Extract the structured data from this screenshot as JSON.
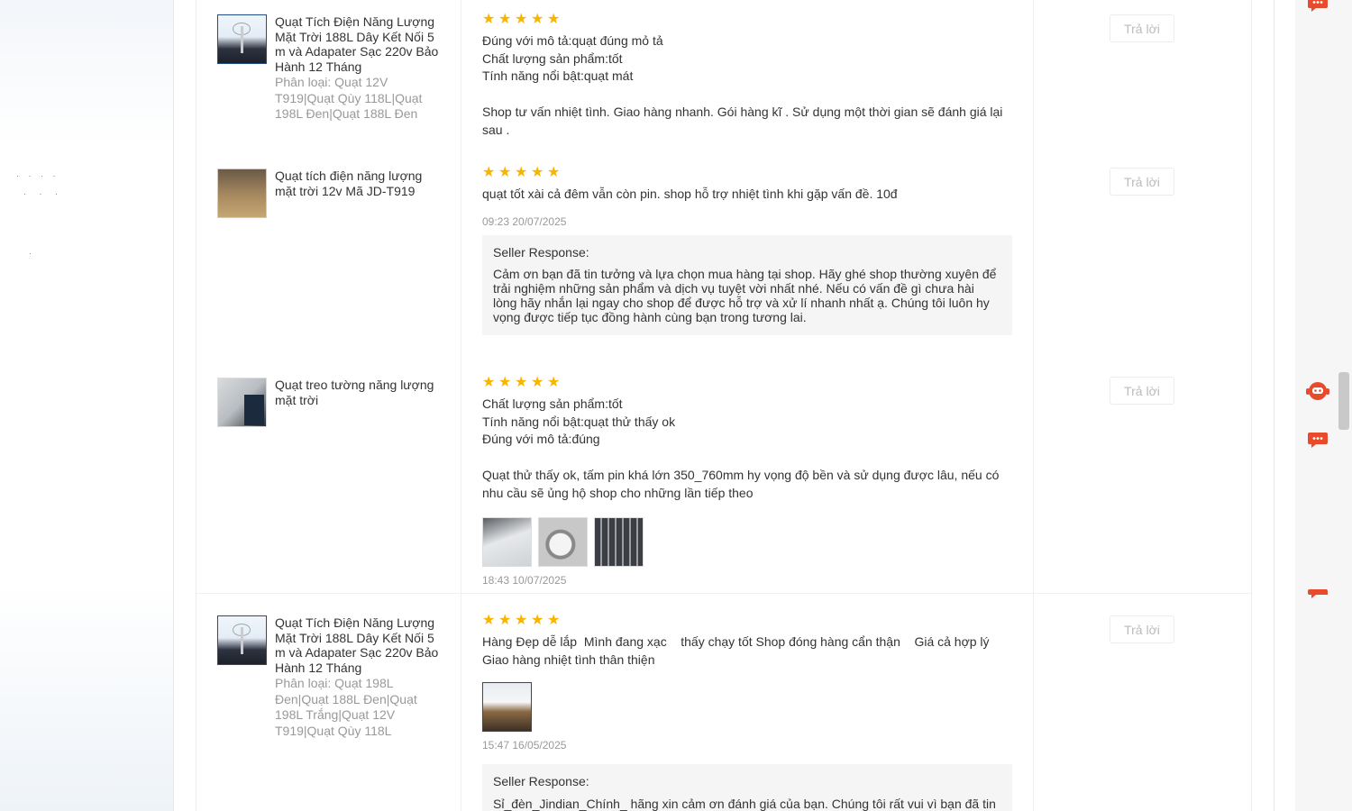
{
  "reviews": [
    {
      "product_name": "Quạt Tích Điện Năng Lượng Mặt Trời 188L Dây Kết Nối 5 m và Adapater Sạc 220v Bảo Hành 12 Tháng",
      "variant": "Phân loại: Quạt 12V T919|Quạt Qùy 118L|Quạt 198L Đen|Quạt 188L Đen",
      "rating": 5,
      "lines": [
        "Đúng với mô tả:quạt đúng mỏ tả",
        "Chất lượng sản phẩm:tốt",
        "Tính năng nổi bật:quạt mát"
      ],
      "comment": "Shop tư vấn nhiệt tình. Giao hàng nhanh. Gói hàng kĩ . Sử dụng một thời gian sẽ đánh giá lại sau .",
      "reply_label": "Trả lời"
    },
    {
      "product_name": "Quạt tích điện năng lượng mặt trời 12v Mã JD-T919",
      "rating": 5,
      "comment": "quạt tốt xài cả đêm vẫn còn pin. shop hỗ trợ nhiệt tình khi gặp vấn đề. 10đ",
      "time": "09:23 20/07/2025",
      "seller_title": "Seller Response:",
      "seller_text": "Cảm ơn bạn đã tin tưởng và lựa chọn mua hàng tại shop. Hãy ghé shop thường xuyên để trải nghiệm những sản phẩm và dịch vụ tuyệt vời nhất nhé. Nếu có vấn đề gì chưa hài lòng hãy nhắn lại ngay cho shop để được hỗ trợ và xử lí nhanh nhất ạ. Chúng tôi luôn hy vọng được tiếp tục đồng hành cùng bạn trong tương lai.",
      "reply_label": "Trả lời"
    },
    {
      "product_name": "Quạt treo tường năng lượng mặt trời",
      "rating": 5,
      "lines": [
        "Chất lượng sản phẩm:tốt",
        "Tính năng nổi bật:quạt thử thấy ok",
        "Đúng với mô tả:đúng"
      ],
      "comment": "Quạt thử thấy ok, tấm pin khá lớn 350_760mm hy vọng độ bền và sử dụng được lâu, nếu có nhu cầu sẽ ủng hộ shop cho những lần tiếp theo",
      "time": "18:43 10/07/2025",
      "reply_label": "Trả lời"
    },
    {
      "product_name": "Quạt Tích Điện Năng Lượng Mặt Trời 188L Dây Kết Nối 5 m và Adapater Sạc 220v Bảo Hành 12 Tháng",
      "variant": "Phân loại: Quạt 198L Đen|Quạt 188L Đen|Quạt 198L Trắng|Quạt 12V T919|Quạt Qùy 118L",
      "rating": 5,
      "comment": "Hàng Đẹp dễ lắp  Mình đang xạc    thấy chạy tốt Shop đóng hàng cẩn thận    Giá cả hợp lý Giao hàng nhiệt tình thân thiện",
      "time": "15:47 16/05/2025",
      "seller_title": "Seller Response:",
      "seller_text": "Sỉ_đèn_Jindian_Chính_ hãng xin cảm ơn đánh giá của bạn. Chúng tôi rất vui vì bạn đã tin tưởng sử dụng sản phẩm của shop. Chúng tôi luôn hy vọng mang lại sự hài lòng cho Quý khách.",
      "reply_label": "Trả lời"
    }
  ],
  "icons": [
    "chat-icon",
    "robot-support-icon",
    "chat-icon",
    "chat-icon"
  ],
  "colors": {
    "star": "#f7b500",
    "accent": "#e84a2c",
    "muted": "#999999",
    "seller_bg": "#f5f5f5"
  }
}
